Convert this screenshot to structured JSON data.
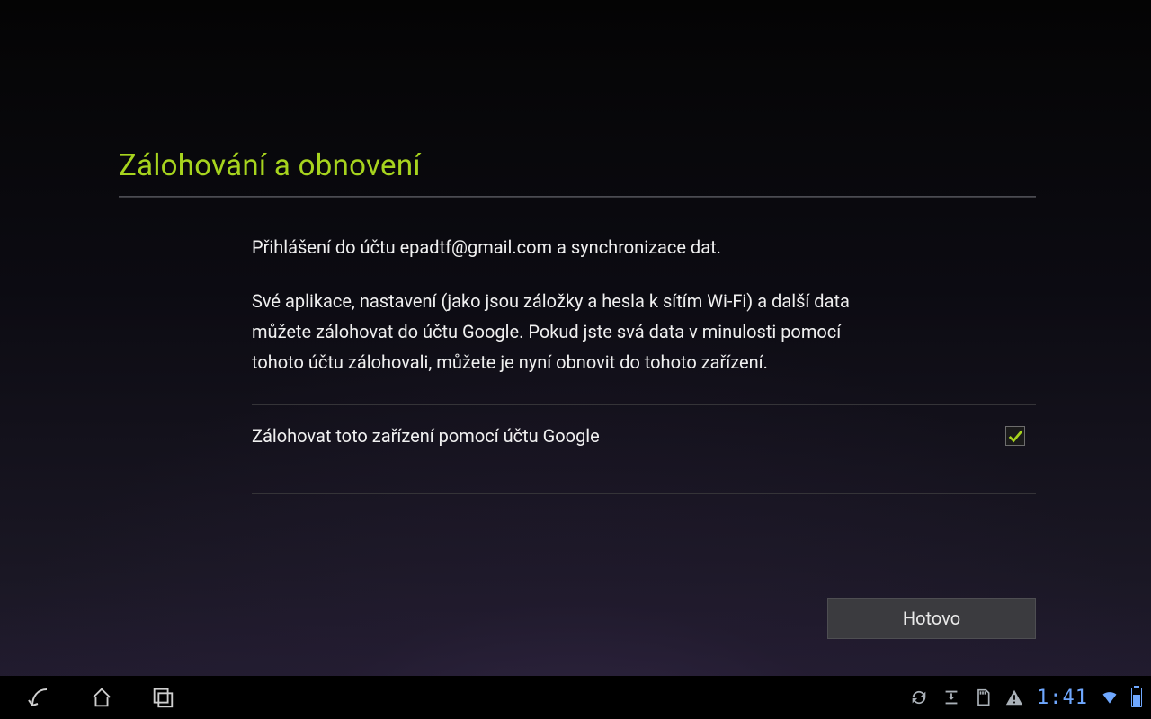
{
  "header": {
    "title": "Zálohování a obnovení"
  },
  "body": {
    "line1": "Přihlášení do účtu epadtf@gmail.com a synchronizace dat.",
    "line2": "Své aplikace, nastavení (jako jsou záložky a hesla k sítím Wi-Fi) a další data můžete zálohovat do účtu Google. Pokud jste svá data v minulosti pomocí tohoto účtu zálohovali, můžete je nyní obnovit do tohoto zařízení.",
    "checkbox_label": "Zálohovat toto zařízení pomocí účtu Google",
    "checkbox_checked": true
  },
  "actions": {
    "done": "Hotovo"
  },
  "statusbar": {
    "time": "1:41"
  }
}
